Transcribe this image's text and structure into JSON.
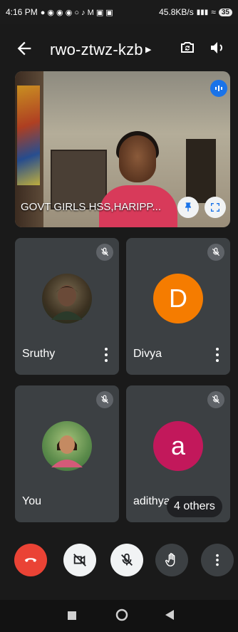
{
  "status_bar": {
    "time": "4:16 PM",
    "data_speed": "45.8KB/s",
    "battery": "35"
  },
  "header": {
    "meeting_code": "rwo-ztwz-kzb"
  },
  "main_video": {
    "label": "GOVT GIRLS HSS,HARIPP..."
  },
  "participants": [
    {
      "name": "Sruthy",
      "type": "photo"
    },
    {
      "name": "Divya",
      "type": "initial",
      "initial": "D",
      "color": "#f57c00"
    },
    {
      "name": "You",
      "type": "photo"
    },
    {
      "name": "adithya",
      "type": "initial",
      "initial": "a",
      "color": "#c2185b"
    }
  ],
  "others_badge": "4 others",
  "colors": {
    "end_call": "#ea4335",
    "tile_bg": "#3c4043",
    "accent_blue": "#1a73e8"
  }
}
